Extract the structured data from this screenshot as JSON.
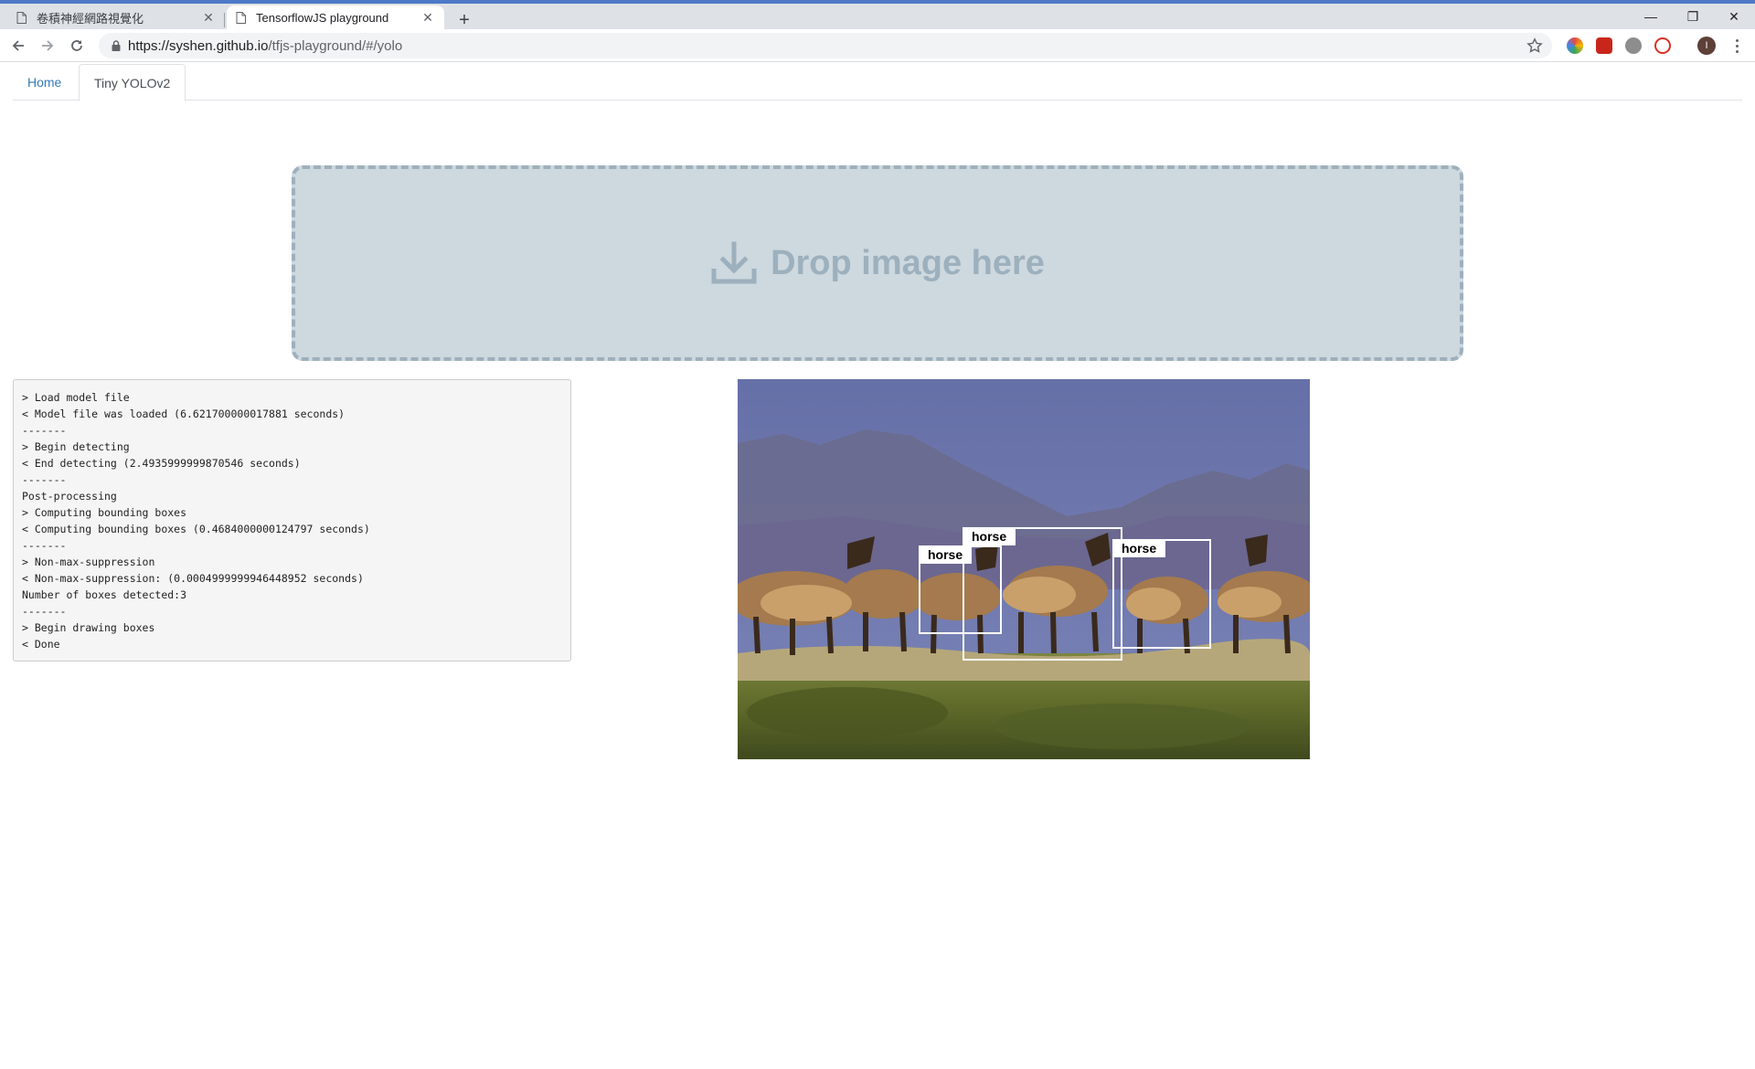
{
  "browser": {
    "tabs": [
      {
        "title": "卷積神經網路視覺化",
        "close": "✕",
        "active": false
      },
      {
        "title": "TensorflowJS playground",
        "close": "✕",
        "active": true
      }
    ],
    "new_tab": "+",
    "window_controls": {
      "minimize": "—",
      "restore": "❐",
      "close": "✕"
    },
    "url_host": "https://syshen.github.io",
    "url_path": "/tfjs-playground/#/yolo",
    "profile_initial": "I",
    "extension_icons": [
      "ext-colorful",
      "ext-red-square",
      "ext-grey-circle",
      "ext-red-circle"
    ]
  },
  "nav": {
    "tabs": [
      {
        "label": "Home",
        "active": false
      },
      {
        "label": "Tiny YOLOv2",
        "active": true
      }
    ]
  },
  "dropzone": {
    "label": "Drop image here",
    "icon": "download-icon"
  },
  "log": {
    "lines": [
      "> Load model file",
      "< Model file was loaded (6.621700000017881 seconds)",
      "-------",
      "> Begin detecting",
      "< End detecting (2.4935999999870546 seconds)",
      "-------",
      "Post-processing",
      "> Computing bounding boxes",
      "< Computing bounding boxes (0.4684000000124797 seconds)",
      "-------",
      "> Non-max-suppression",
      "< Non-max-suppression: (0.0004999999946448952 seconds)",
      "Number of boxes detected:3",
      "-------",
      "> Begin drawing boxes",
      "< Done"
    ]
  },
  "detections": {
    "image_subject": "herd of horses on grassland",
    "boxes": [
      {
        "label": "horse"
      },
      {
        "label": "horse"
      },
      {
        "label": "horse"
      }
    ]
  }
}
